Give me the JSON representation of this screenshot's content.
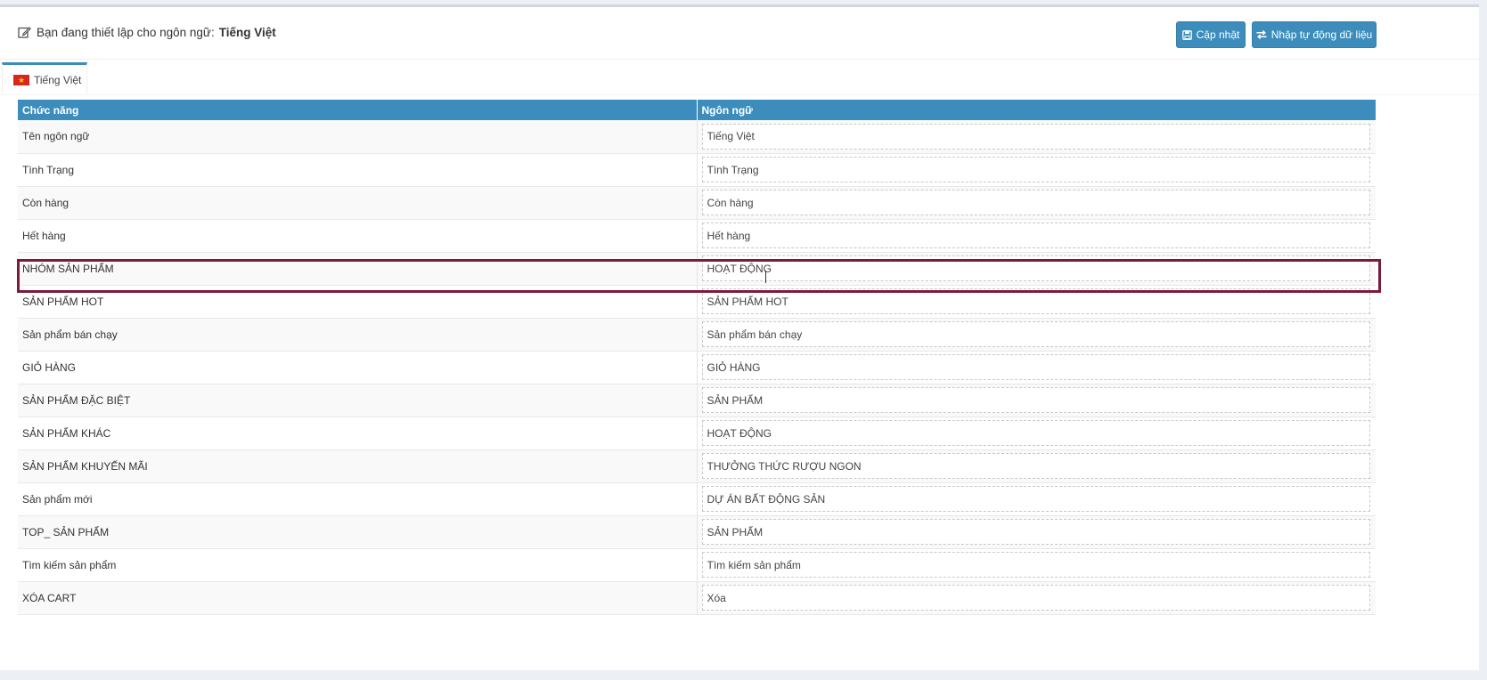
{
  "header": {
    "prefix": "Bạn đang thiết lập cho ngôn ngữ:",
    "language": "Tiếng Việt",
    "update_label": "Cập nhật",
    "import_label": "Nhập tự động dữ liệu"
  },
  "tabs": [
    {
      "label": "Tiếng Việt",
      "flag": "vietnam-flag"
    }
  ],
  "table": {
    "columns": [
      "Chức năng",
      "Ngôn ngữ"
    ],
    "rows": [
      {
        "function": "Tên ngôn ngữ",
        "value": "Tiếng Việt"
      },
      {
        "function": "Tình Trạng",
        "value": "Tình Trạng"
      },
      {
        "function": "Còn hàng",
        "value": "Còn hàng"
      },
      {
        "function": "Hết hàng",
        "value": "Hết hàng"
      },
      {
        "function": "NHÓM SẢN PHẨM",
        "value": "HOẠT ĐỘNG"
      },
      {
        "function": "SẢN PHẨM HOT",
        "value": "SẢN PHẨM HOT"
      },
      {
        "function": "Sản phẩm bán chạy",
        "value": "Sản phẩm bán chạy"
      },
      {
        "function": "GIỎ HÀNG",
        "value": "GIỎ HÀNG"
      },
      {
        "function": "SẢN PHẨM ĐẶC BIỆT",
        "value": "SẢN PHẨM"
      },
      {
        "function": "SẢN PHẨM KHÁC",
        "value": "HOẠT ĐỘNG"
      },
      {
        "function": "SẢN PHẨM KHUYẾN MÃI",
        "value": "THƯỞNG THỨC RƯỢU NGON"
      },
      {
        "function": "Sản phẩm mới",
        "value": "DỰ ÁN BẤT ĐỘNG SẢN"
      },
      {
        "function": "TOP_ SẢN PHẨM",
        "value": "SẢN PHẨM"
      },
      {
        "function": "Tìm kiếm sản phẩm",
        "value": "Tìm kiếm sản phẩm"
      },
      {
        "function": "XÓA CART",
        "value": "Xóa"
      }
    ]
  },
  "colors": {
    "primary": "#3c8dbc",
    "highlight": "#7b1b3a",
    "flag_red": "#da251d",
    "flag_star": "#ffcd00"
  }
}
